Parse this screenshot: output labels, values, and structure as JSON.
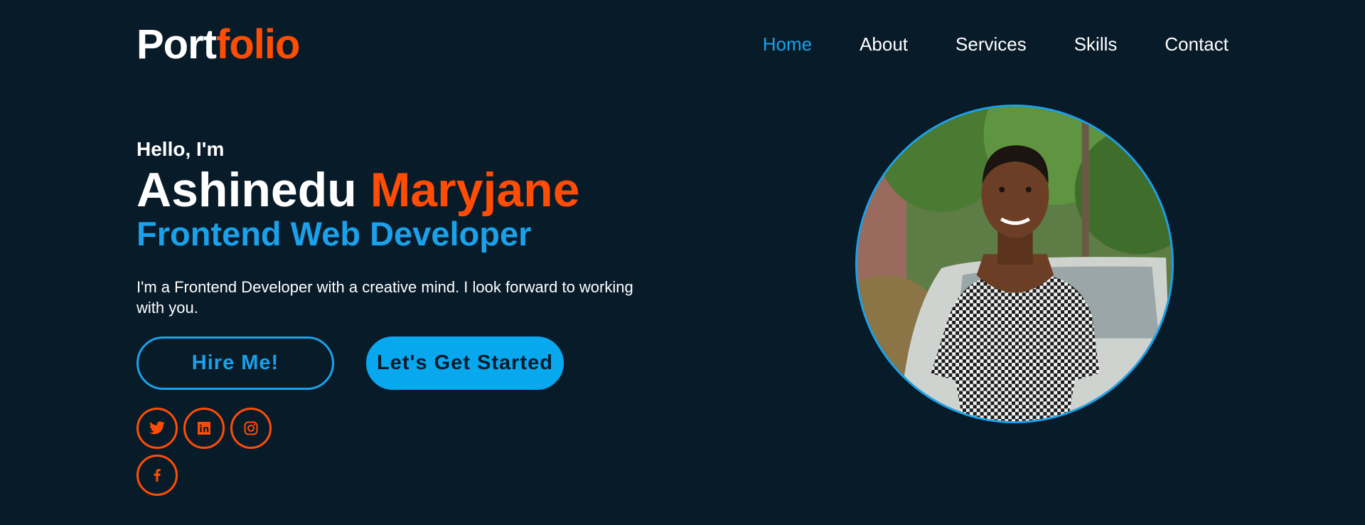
{
  "header": {
    "logo_main": "Port",
    "logo_accent": "folio",
    "nav": [
      "Home",
      "About",
      "Services",
      "Skills",
      "Contact"
    ],
    "active_nav": "Home"
  },
  "hero": {
    "greeting": "Hello, I'm",
    "first_name": "Ashinedu",
    "last_name": "Maryjane",
    "role": "Frontend Web Developer",
    "description": "I'm a Frontend Developer with a creative mind. I look forward to working with you.",
    "primary_button": "Hire Me!",
    "secondary_button": "Let's Get Started"
  },
  "socials": [
    {
      "icon": "twitter-icon"
    },
    {
      "icon": "linkedin-icon"
    },
    {
      "icon": "instagram-icon"
    },
    {
      "icon": "facebook-icon"
    }
  ],
  "colors": {
    "background": "#081b29",
    "accent_orange": "#ff4d05",
    "accent_blue": "#1ba1ea",
    "text": "#ffffff"
  }
}
